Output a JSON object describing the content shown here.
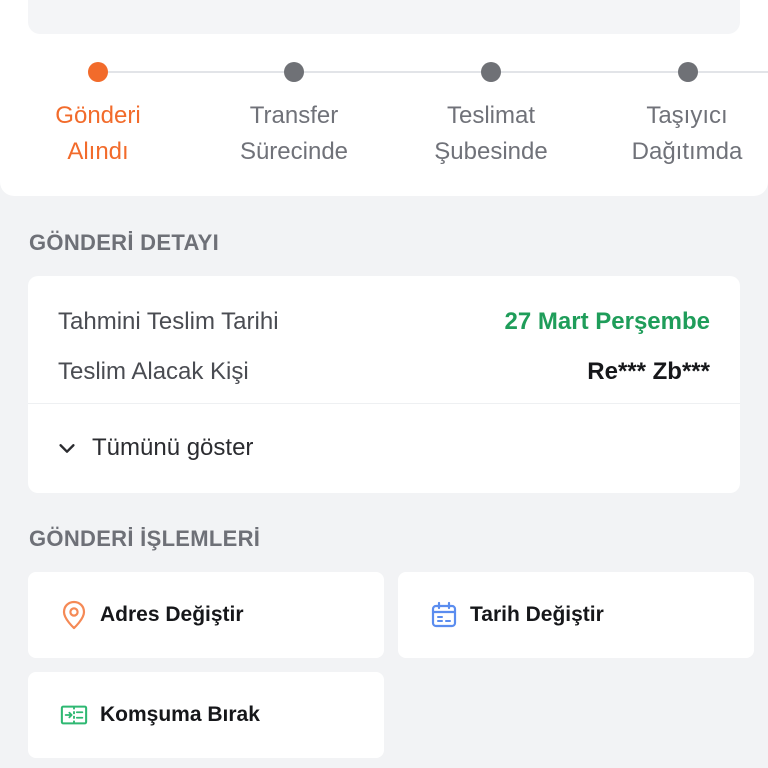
{
  "steps": [
    {
      "line1": "Gönderi",
      "line2": "Alındı",
      "active": true
    },
    {
      "line1": "Transfer",
      "line2": "Sürecinde",
      "active": false
    },
    {
      "line1": "Teslimat",
      "line2": "Şubesinde",
      "active": false
    },
    {
      "line1": "Taşıyıcı",
      "line2": "Dağıtımda",
      "active": false
    }
  ],
  "detail": {
    "title": "GÖNDERİ DETAYI",
    "estimated_label": "Tahmini Teslim Tarihi",
    "estimated_value": "27 Mart Perşembe",
    "recipient_label": "Teslim Alacak Kişi",
    "recipient_value": "Re*** Zb***",
    "show_all": "Tümünü göster"
  },
  "actions": {
    "title": "GÖNDERİ İŞLEMLERİ",
    "change_address": "Adres Değiştir",
    "change_date": "Tarih Değiştir",
    "leave_neighbor": "Komşuma Bırak"
  },
  "colors": {
    "accent": "#f26b2b",
    "inactive": "#6f7176",
    "success": "#1f9d5a",
    "date_icon": "#5b8def",
    "neighbor_icon": "#2eb872"
  }
}
